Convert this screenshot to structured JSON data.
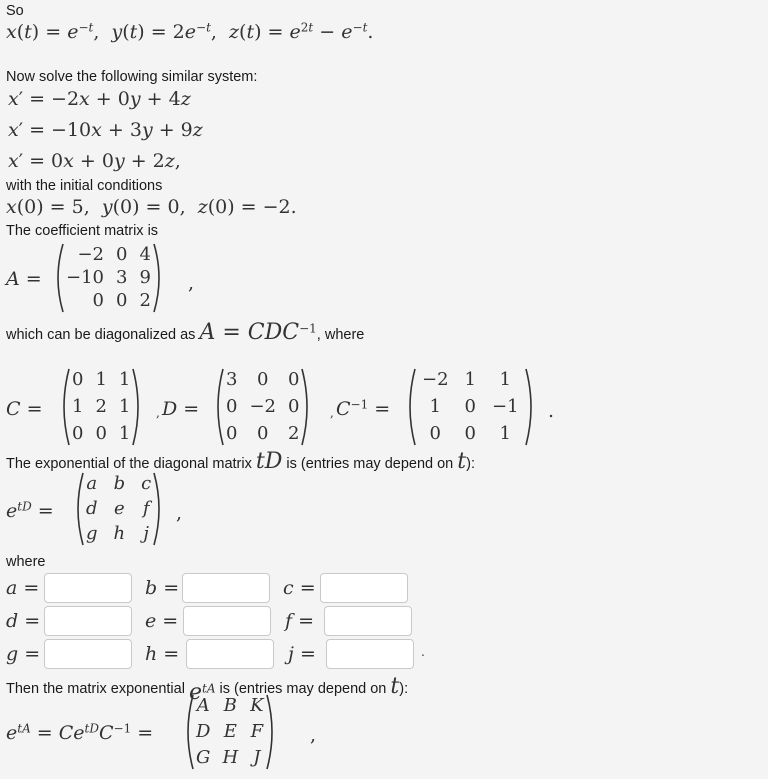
{
  "intro": {
    "so_label": "So",
    "solution_line": {
      "x": "x(t) = e^{−t}",
      "y": "y(t) = 2e^{−t}",
      "z": "z(t) = e^{2t} − e^{−t}"
    }
  },
  "problem": {
    "prompt": "Now solve the following similar system:",
    "equations": [
      "x′ = −2x + 0y + 4z",
      "x′ = −10x + 3y + 9z",
      "x′ = 0x + 0y + 2z,"
    ],
    "initial_conditions_label": "with the initial conditions",
    "initial_conditions": "x(0) = 5,  y(0) = 0,  z(0) = −2."
  },
  "coefficient": {
    "label": "The coefficient matrix is",
    "matrix_name": "A =",
    "A": [
      [
        "−2",
        "0",
        "4"
      ],
      [
        "−10",
        "3",
        "9"
      ],
      [
        "0",
        "0",
        "2"
      ]
    ],
    "trailing": ","
  },
  "diagonalization": {
    "text_before": "which can be diagonalized as",
    "formula": "A = CDC",
    "formula_sup": "−1",
    "text_after": ", where",
    "C_label": "C =",
    "C": [
      [
        "0",
        "1",
        "1"
      ],
      [
        "1",
        "2",
        "1"
      ],
      [
        "0",
        "0",
        "1"
      ]
    ],
    "D_label": "D =",
    "D": [
      [
        "3",
        "0",
        "0"
      ],
      [
        "0",
        "−2",
        "0"
      ],
      [
        "0",
        "0",
        "2"
      ]
    ],
    "Cinv_label": "C",
    "Cinv_sup": "−1",
    "Cinv_eq": "=",
    "Cinv": [
      [
        "−2",
        "1",
        "1"
      ],
      [
        "1",
        "0",
        "−1"
      ],
      [
        "0",
        "0",
        "1"
      ]
    ],
    "sep": ",",
    "end": "."
  },
  "exp_diag": {
    "text_before": "The exponential of the diagonal matrix",
    "tD": "tD",
    "text_mid": "is (entries may depend on",
    "t": "t",
    "text_end": "):",
    "lhs_base": "e",
    "lhs_sup": "tD",
    "eq": "=",
    "M": [
      [
        "a",
        "b",
        "c"
      ],
      [
        "d",
        "e",
        "f"
      ],
      [
        "g",
        "h",
        "j"
      ]
    ],
    "trailing": ","
  },
  "answers": {
    "where_label": "where",
    "fields": [
      {
        "var": "a",
        "value": ""
      },
      {
        "var": "b",
        "value": ""
      },
      {
        "var": "c",
        "value": ""
      },
      {
        "var": "d",
        "value": ""
      },
      {
        "var": "e",
        "value": ""
      },
      {
        "var": "f",
        "value": ""
      },
      {
        "var": "g",
        "value": ""
      },
      {
        "var": "h",
        "value": ""
      },
      {
        "var": "j",
        "value": ""
      }
    ],
    "eq": "=",
    "end": "."
  },
  "exp_A": {
    "text_before": "Then the matrix exponential",
    "etA_base": "e",
    "etA_sup": "tA",
    "text_mid": "is (entries may depend on",
    "t": "t",
    "text_end": "):",
    "lhs": "e",
    "lhs_sup": "tA",
    "rhs1": "= Ce",
    "rhs1_sup": "tD",
    "rhs2": "C",
    "rhs2_sup": "−1",
    "eq": "=",
    "M": [
      [
        "A",
        "B",
        "K"
      ],
      [
        "D",
        "E",
        "F"
      ],
      [
        "G",
        "H",
        "J"
      ]
    ],
    "trailing": ","
  }
}
